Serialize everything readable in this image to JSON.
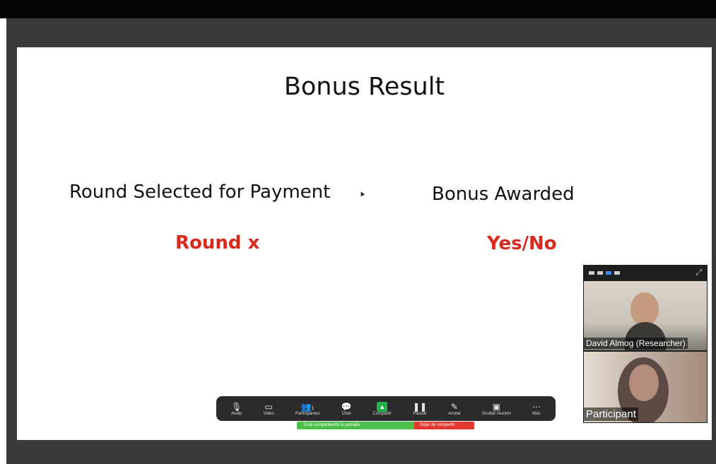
{
  "slide": {
    "title": "Bonus Result",
    "left_label": "Round Selected for Payment",
    "left_value": "Round x",
    "right_label": "Bonus Awarded",
    "right_value": "Yes/No"
  },
  "video": {
    "researcher_name": "David Almog (Researcher)",
    "participant_name": "Participant"
  },
  "toolbar": {
    "items": [
      {
        "label": "Audio",
        "icon": "microphone-icon"
      },
      {
        "label": "Video",
        "icon": "video-camera-icon"
      },
      {
        "label": "Participantes",
        "icon": "participants-icon",
        "count": "1"
      },
      {
        "label": "Chat",
        "icon": "chat-icon"
      },
      {
        "label": "Compartir",
        "icon": "share-screen-icon"
      },
      {
        "label": "Pausar",
        "icon": "pause-icon"
      },
      {
        "label": "Anotar",
        "icon": "annotate-icon"
      },
      {
        "label": "Ocultar reunión",
        "icon": "hide-meeting-icon"
      },
      {
        "label": "Más",
        "icon": "more-icon"
      }
    ]
  },
  "sharing": {
    "status": "Está compartiendo la pantalla",
    "stop_label": "Dejar de compartir"
  },
  "colors": {
    "accent_red": "#d9291c",
    "share_green": "#4cbf4a",
    "stop_red": "#e2372f"
  }
}
